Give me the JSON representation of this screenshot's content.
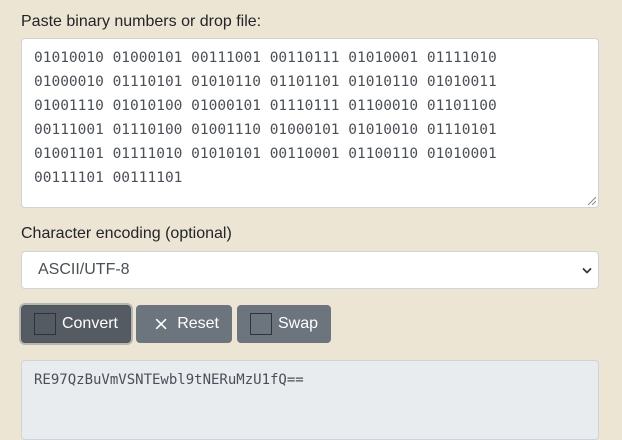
{
  "input": {
    "label": "Paste binary numbers or drop file:",
    "value": "01010010 01000101 00111001 00110111 01010001 01111010\n01000010 01110101 01010110 01101101 01010110 01010011\n01001110 01010100 01000101 01110111 01100010 01101100\n00111001 01110100 01001110 01000101 01010010 01110101\n01001101 01111010 01010101 00110001 01100110 01010001\n00111101 00111101"
  },
  "encoding": {
    "label": "Character encoding (optional)",
    "selected": "ASCII/UTF-8"
  },
  "buttons": {
    "convert_label": "Convert",
    "reset_label": "Reset",
    "swap_label": "Swap"
  },
  "output": {
    "value": "RE97QzBuVmVSNTEwbl9tNERuMzU1fQ=="
  },
  "icons": {
    "convert": "square-icon",
    "reset": "close-icon",
    "swap": "square-icon",
    "select": "chevron-down-icon"
  },
  "colors": {
    "page_background": "#ede5d3",
    "button_background": "#6c757d",
    "button_active": "#545b62",
    "output_background": "#e9ecef"
  }
}
